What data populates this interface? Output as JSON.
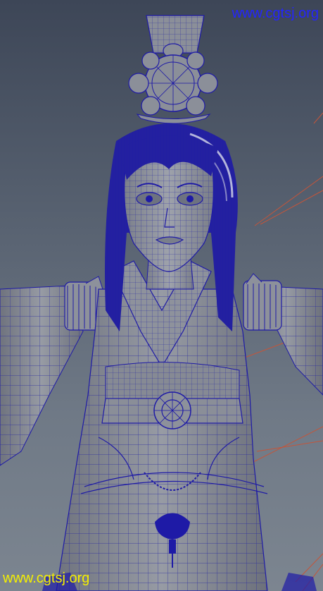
{
  "viewport": {
    "background_top": "#3d4657",
    "background_bottom": "#7c8590",
    "model_fill": "#8b8f99",
    "wire_color": "#1e1aa6",
    "guide_line_color": "#c4553a"
  },
  "watermarks": {
    "top": {
      "text": "www.cgtsj.org",
      "color": "#2424ff"
    },
    "bottom": {
      "text": "www.cgtsj.org",
      "color": "#f5f000"
    }
  }
}
